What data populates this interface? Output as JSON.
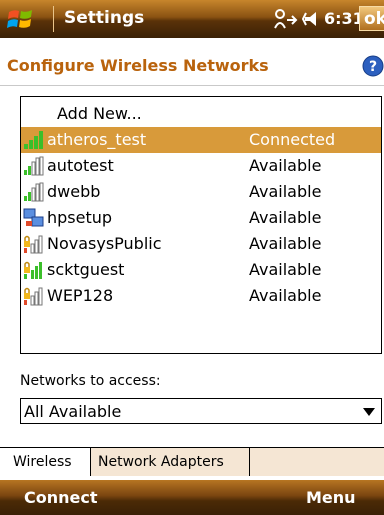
{
  "titlebar": {
    "app_title": "Settings",
    "time": "6:31",
    "ok_label": "ok"
  },
  "page": {
    "title": "Configure Wireless Networks"
  },
  "networks": {
    "add_new_label": "Add New...",
    "items": [
      {
        "name": "atheros_test",
        "status": "Connected",
        "icon": "signal-strength-icon",
        "selected": true
      },
      {
        "name": "autotest",
        "status": "Available",
        "icon": "signal-strength-icon"
      },
      {
        "name": "dwebb",
        "status": "Available",
        "icon": "signal-strength-icon"
      },
      {
        "name": "hpsetup",
        "status": "Available",
        "icon": "ad-hoc-computer-icon"
      },
      {
        "name": "NovasysPublic",
        "status": "Available",
        "icon": "secured-signal-icon"
      },
      {
        "name": "scktguest",
        "status": "Available",
        "icon": "secured-signal-icon"
      },
      {
        "name": "WEP128",
        "status": "Available",
        "icon": "secured-signal-icon"
      }
    ]
  },
  "access": {
    "label": "Networks to access:",
    "selected": "All Available"
  },
  "tabs": [
    {
      "label": "Wireless"
    },
    {
      "label": "Network Adapters"
    }
  ],
  "softkeys": {
    "left": "Connect",
    "right": "Menu"
  },
  "colors": {
    "title_accent": "#b9630d",
    "selection": "#d89a3a",
    "bar_brown": "#5a3208"
  }
}
